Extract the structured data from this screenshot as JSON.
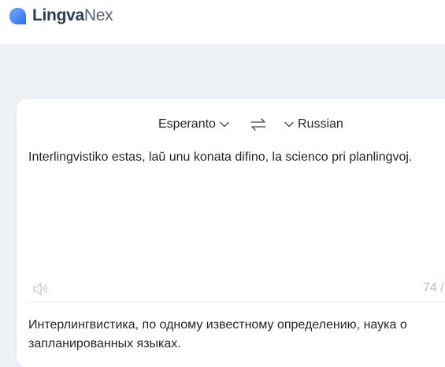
{
  "header": {
    "logo_part1": "Lingva",
    "logo_part2": "Nex",
    "logo_color": "#4f8bf5"
  },
  "translator": {
    "source_language": "Esperanto",
    "target_language": "Russian",
    "source_text": "Interlingvistiko estas, laŭ unu konata difino, la scienco pri planlingvoj.",
    "char_count": "74 /",
    "translation_text": "Интерлингвистика, по одному известному определению, наука о запланированных языках.",
    "icons": {
      "source_dropdown": "chevron-down-icon",
      "swap": "swap-icon",
      "target_dropdown": "chevron-down-icon",
      "speaker": "speaker-icon"
    }
  }
}
